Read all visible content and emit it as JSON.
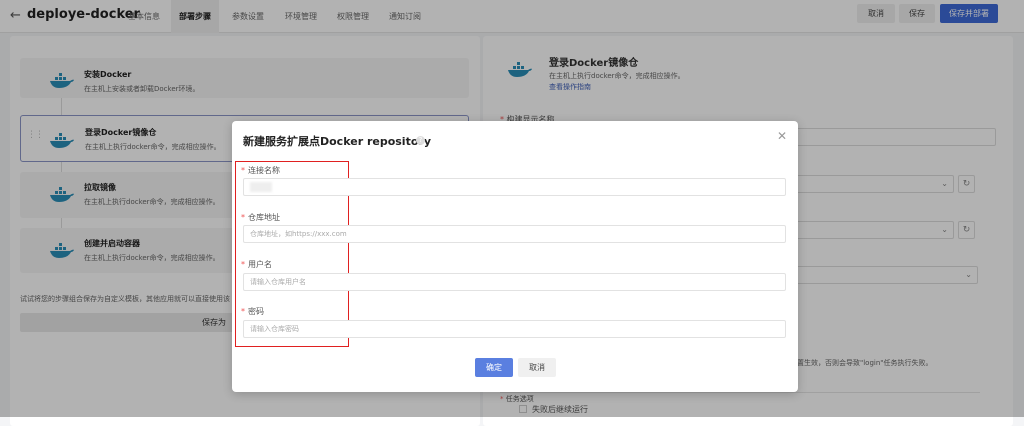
{
  "header": {
    "back_icon": "arrow-left-icon",
    "title": "deploye-docker",
    "tabs": [
      "基本信息",
      "部署步骤",
      "参数设置",
      "环境管理",
      "权限管理",
      "通知订阅"
    ],
    "active_tab": 1,
    "buttons": {
      "cancel": "取消",
      "save": "保存",
      "save_deploy": "保存并部署"
    }
  },
  "steps": [
    {
      "title": "安装Docker",
      "desc": "在主机上安装或者卸载Docker环境。"
    },
    {
      "title": "登录Docker镜像仓",
      "desc": "在主机上执行docker命令，完成相应操作。"
    },
    {
      "title": "拉取镜像",
      "desc": "在主机上执行docker命令，完成相应操作。"
    },
    {
      "title": "创建并启动容器",
      "desc": "在主机上执行docker命令，完成相应操作。"
    }
  ],
  "left": {
    "hint": "试试将您的步骤组合保存为自定义模板，其他应用就可以直接使用该",
    "save_template": "保存为"
  },
  "right": {
    "title": "登录Docker镜像仓",
    "desc": "在主机上执行docker命令，完成相应操作。",
    "guide_link": "查看操作指南",
    "field1_label": "构建显示名称",
    "note": "配置生效，否则会导致\"login\"任务执行失败。",
    "options_label": "任务选项",
    "checkbox": "失败后继续运行"
  },
  "modal": {
    "title": "新建服务扩展点Docker repository",
    "help_icon": "question-circle-icon",
    "close_icon": "close-icon",
    "fields": [
      {
        "label": "连接名称",
        "placeholder": ""
      },
      {
        "label": "仓库地址",
        "placeholder": "仓库地址，如https://xxx.com"
      },
      {
        "label": "用户名",
        "placeholder": "请输入仓库用户名"
      },
      {
        "label": "密码",
        "placeholder": "请输入仓库密码"
      }
    ],
    "confirm": "确定",
    "cancel": "取消"
  },
  "colors": {
    "primary": "#3e6ad8",
    "highlight": "#e02020",
    "docker": "#2a8fb8"
  }
}
